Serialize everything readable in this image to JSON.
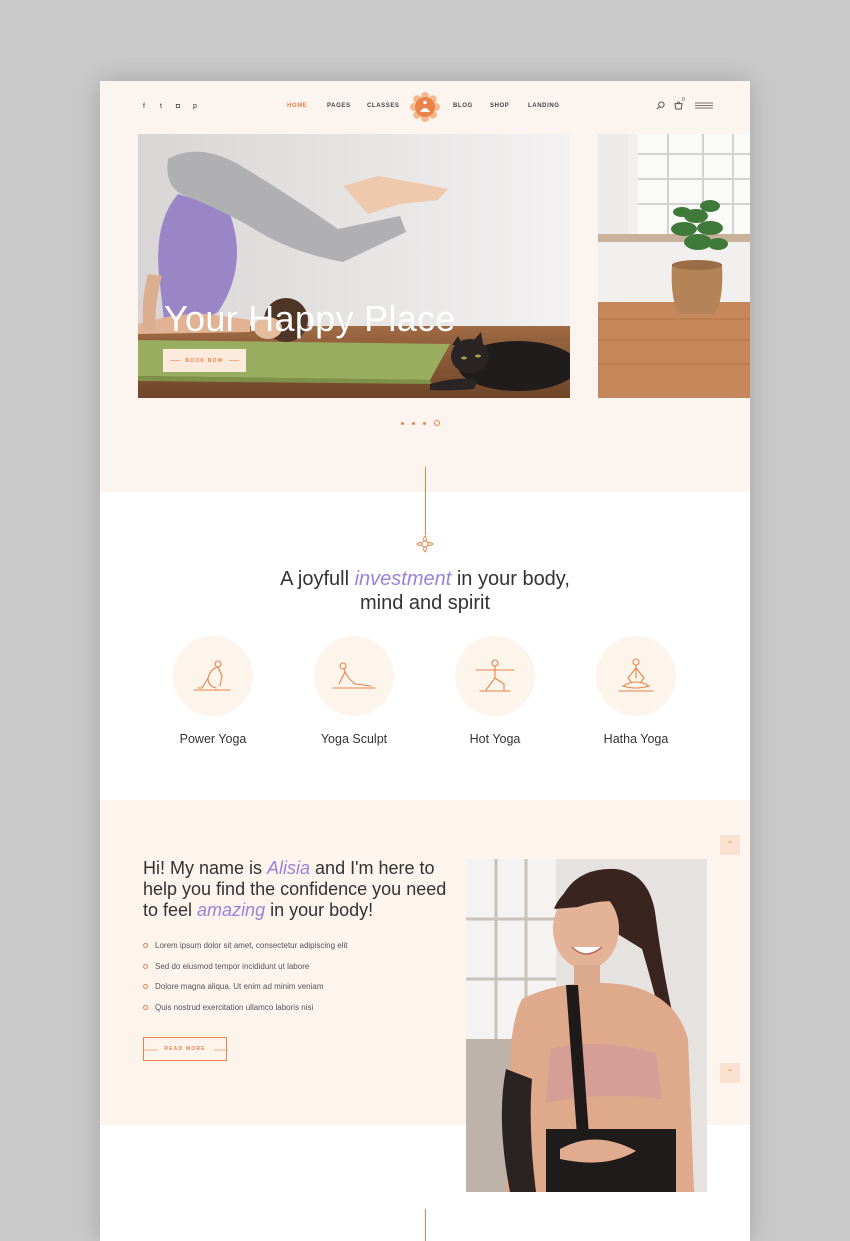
{
  "header": {
    "social": [
      {
        "icon": "facebook-icon",
        "glyph": "f"
      },
      {
        "icon": "twitter-icon",
        "glyph": "t"
      },
      {
        "icon": "instagram-icon",
        "glyph": "◘"
      },
      {
        "icon": "pinterest-icon",
        "glyph": "p"
      }
    ],
    "nav": [
      {
        "label": "HOME",
        "active": true
      },
      {
        "label": "PAGES",
        "active": false
      },
      {
        "label": "CLASSES",
        "active": false
      },
      {
        "label": "BLOG",
        "active": false
      },
      {
        "label": "SHOP",
        "active": false
      },
      {
        "label": "LANDING",
        "active": false
      }
    ],
    "cart_count": "0"
  },
  "hero": {
    "title": "Your Happy Place",
    "button": "BOOK NOW",
    "slides_total": 4,
    "active_slide": 4
  },
  "intro": {
    "tagline_a": "A joyfull ",
    "tagline_em": "investment",
    "tagline_b": " in your body,",
    "tagline_c": "mind and spirit"
  },
  "classes": [
    {
      "name": "Power Yoga",
      "icon": "power-yoga-pose-icon"
    },
    {
      "name": "Yoga Sculpt",
      "icon": "yoga-sculpt-pose-icon"
    },
    {
      "name": "Hot Yoga",
      "icon": "hot-yoga-pose-icon"
    },
    {
      "name": "Hatha Yoga",
      "icon": "hatha-yoga-pose-icon"
    }
  ],
  "about": {
    "t1": "Hi! My name is ",
    "name": "Alisia",
    "t2": " and I'm here to help you find the confidence you need to feel ",
    "em": "amazing",
    "t3": " in your body!",
    "bullets": [
      "Lorem ipsum dolor sit amet, consectetur adipiscing elit",
      "Sed do eiusmod tempor incididunt ut labore",
      "Dolore magna aliqua. Ut enim ad minim veniam",
      "Quis nostrud exercitation ullamco laboris nisi"
    ],
    "button": "READ MORE"
  },
  "colors": {
    "accent": "#e8834a",
    "lilac": "#9a82d6",
    "cream": "#fcf5ef"
  }
}
